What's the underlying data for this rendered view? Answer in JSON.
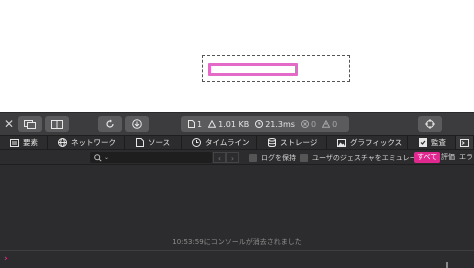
{
  "toolbar": {
    "close_icon": "close-icon",
    "metrics": {
      "resources": "1",
      "size": "1.01 KB",
      "time": "21.3ms",
      "errors": "0",
      "warnings": "0"
    }
  },
  "tabs": [
    {
      "label": "要素",
      "icon": "elements-icon"
    },
    {
      "label": "ネットワーク",
      "icon": "network-icon"
    },
    {
      "label": "ソース",
      "icon": "sources-icon"
    },
    {
      "label": "タイムライン",
      "icon": "timelines-icon"
    },
    {
      "label": "ストレージ",
      "icon": "storage-icon"
    },
    {
      "label": "グラフィックス",
      "icon": "graphics-icon"
    },
    {
      "label": "監査",
      "icon": "audit-icon"
    }
  ],
  "filter": {
    "search_placeholder": "",
    "preserve_log": "ログを保持",
    "emulate_gesture": "ユーザのジェスチャをエミュレート",
    "level_all": "すべて",
    "level_evaluations": "評価",
    "level_errors": "エラ"
  },
  "console": {
    "cleared_message": "10:53:59にコンソールが消去されました",
    "prompt": "›"
  },
  "colors": {
    "accent": "#e0298f",
    "highlight_box": "#e36bc7",
    "panel_bg": "#2c2c2e",
    "toolbar_bg": "#3c3c3e"
  }
}
